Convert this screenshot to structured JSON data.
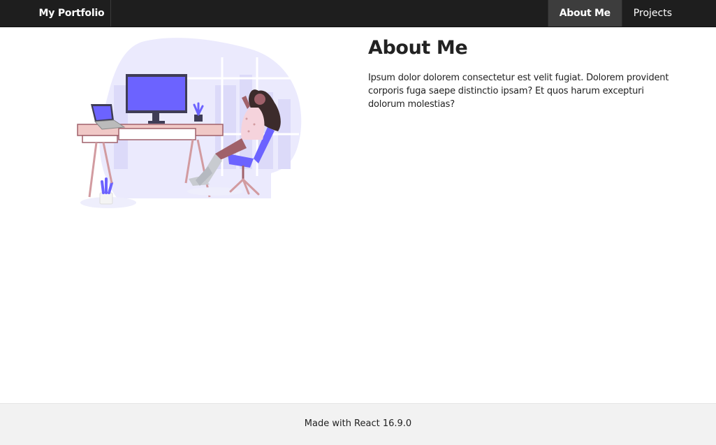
{
  "navbar": {
    "brand": "My Portfolio",
    "items": [
      {
        "label": "About Me",
        "active": true
      },
      {
        "label": "Projects",
        "active": false
      }
    ]
  },
  "illustration": {
    "icon": "working-from-home-illustration",
    "accent_color": "#6c63ff",
    "skin_color": "#a0616a",
    "desk_color": "#f0c8c6"
  },
  "about": {
    "title": "About Me",
    "body": "Ipsum dolor dolorem consectetur est velit fugiat. Dolorem provident corporis fuga saepe distinctio ipsam? Et quos harum excepturi dolorum molestias?"
  },
  "footer": {
    "text": "Made with React 16.9.0"
  },
  "colors": {
    "navbar_bg": "#1e1e1e",
    "navbar_active_bg": "#3d3d3d",
    "footer_bg": "#f2f2f2"
  }
}
